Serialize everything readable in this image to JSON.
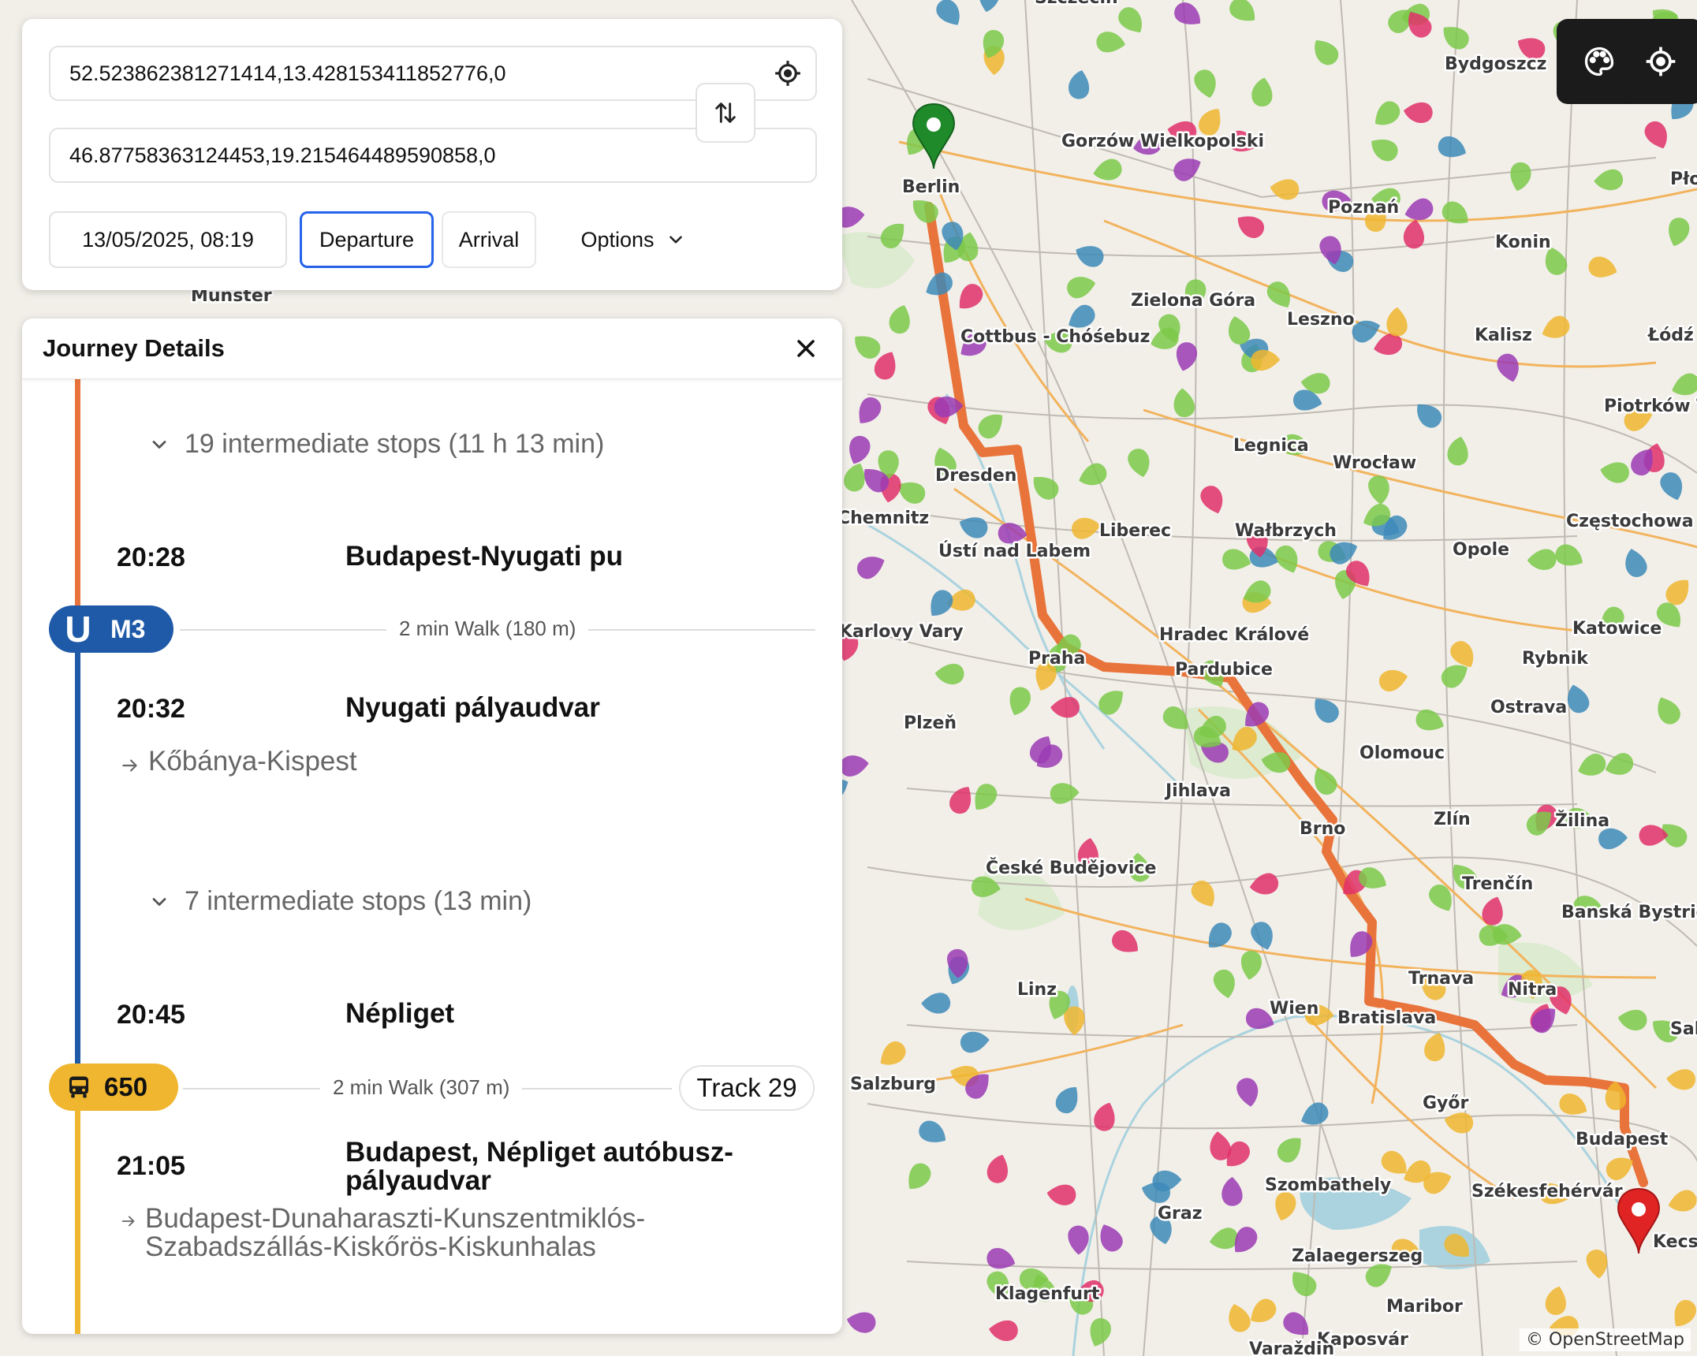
{
  "search": {
    "origin_value": "52.523862381271414,13.428153411852776,0",
    "destination_value": "46.87758363124453,19.215464489590858,0",
    "datetime": "13/05/2025, 08:19",
    "departure_label": "Departure",
    "arrival_label": "Arrival",
    "options_label": "Options"
  },
  "map": {
    "attribution": "© OpenStreetMap",
    "cities": [
      "Szczecin",
      "Bydgoszcz",
      "Gorzów Wielkopolski",
      "Berlin",
      "Poznań",
      "Konin",
      "Płock",
      "Zielona Góra",
      "Leszno",
      "Kalisz",
      "Łódź",
      "Cottbus - Chóśebuz",
      "Piotrków T",
      "Munster",
      "Legnica",
      "Wrocław",
      "Dresden",
      "Chemnitz",
      "Częstochowa",
      "Liberec",
      "Wałbrzych",
      "Opole",
      "Ústí nad Labem",
      "Hradec Králové",
      "Katowice",
      "Karlovy Vary",
      "Praha",
      "Pardubice",
      "Rybnik",
      "Ostrava",
      "Plzeň",
      "Olomouc",
      "Jihlava",
      "Brno",
      "Zlín",
      "Žilina",
      "České Budějovice",
      "Trenčín",
      "Banská Bystrica",
      "Trnava",
      "Nitra",
      "Linz",
      "Wien",
      "Bratislava",
      "Salg",
      "Salzburg",
      "Győr",
      "Budapest",
      "Szombathely",
      "Székesfehérvár",
      "Graz",
      "Kecsk",
      "Zalaegerszeg",
      "Klagenfurt",
      "Maribor",
      "Kaposvár",
      "Varaždin"
    ]
  },
  "journey": {
    "title": "Journey Details",
    "stops_1": "19 intermediate stops (11 h 13 min)",
    "stop_a_time": "20:28",
    "stop_a_name": "Budapest-Nyugati pu",
    "m3_line": "M3",
    "m3_symbol": "U",
    "walk_1": "2 min Walk (180 m)",
    "stop_b_time": "20:32",
    "stop_b_name": "Nyugati pályaudvar",
    "stop_b_direction": "Kőbánya-Kispest",
    "stops_2": "7 intermediate stops (13 min)",
    "stop_c_time": "20:45",
    "stop_c_name": "Népliget",
    "bus_line": "650",
    "walk_2": "2 min Walk (307 m)",
    "track": "Track 29",
    "stop_d_time": "21:05",
    "stop_d_name": "Budapest, Népliget autóbusz-pályaudvar",
    "stop_d_direction": "Budapest-Dunaharaszti-Kunszentmiklós-Szabadszállás-Kiskőrös-Kiskunhalas"
  },
  "colors": {
    "rail_route": "#e8743b",
    "metro_m3": "#1e5aa8",
    "bus_650": "#f0b62f",
    "accent": "#2563eb",
    "origin_marker": "#1f8a2a",
    "destination_marker": "#e02424"
  },
  "icons": [
    "locate-icon",
    "swap-icon",
    "chevron-down-icon",
    "close-icon",
    "arrow-right-icon",
    "bus-icon",
    "palette-icon",
    "crosshair-icon",
    "pin-icon"
  ]
}
